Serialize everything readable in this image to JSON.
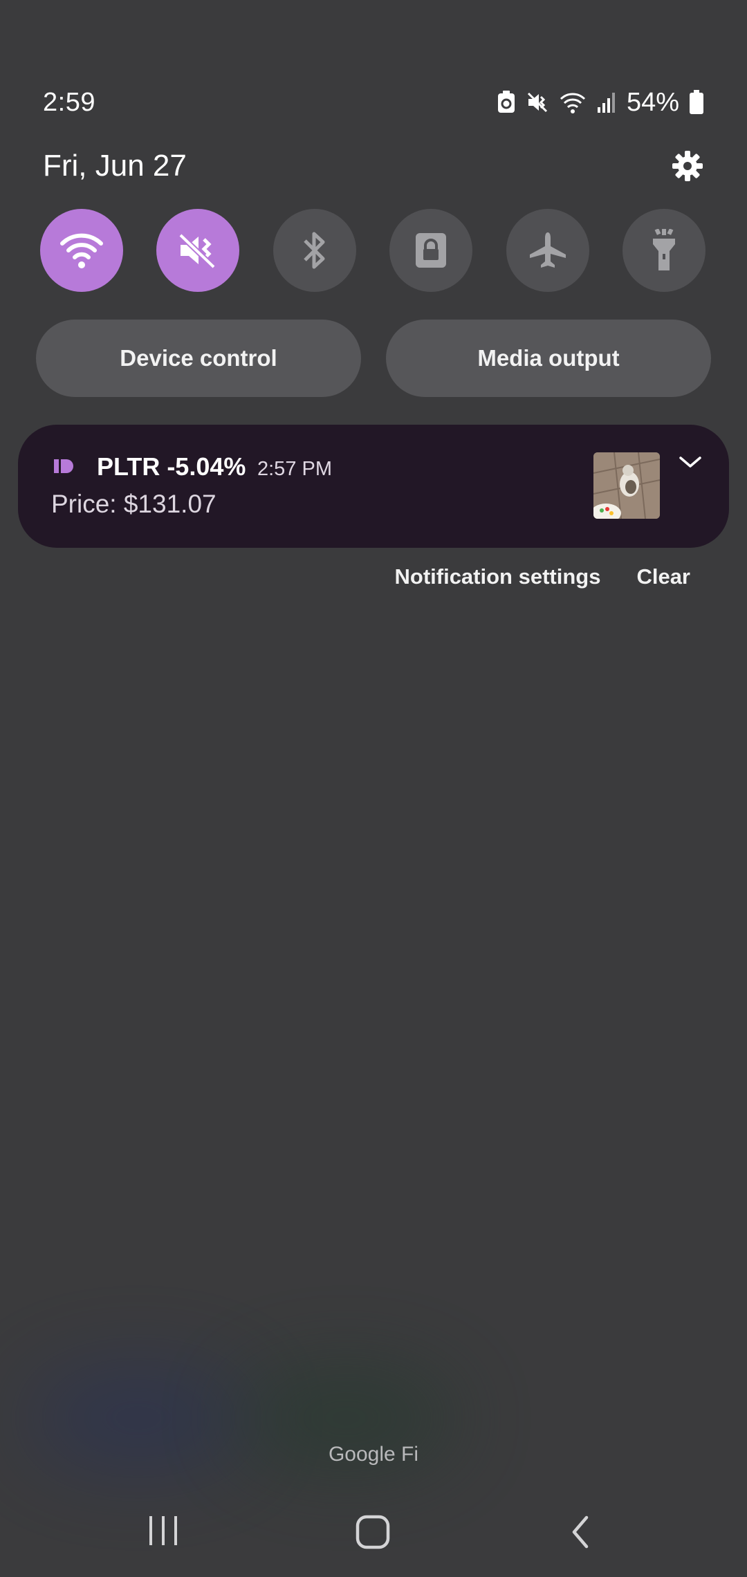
{
  "status_bar": {
    "time": "2:59",
    "battery_percent": "54%",
    "icons": [
      "battery-saver-icon",
      "mute-icon",
      "wifi-icon",
      "signal-icon",
      "battery-icon"
    ]
  },
  "header": {
    "date": "Fri, Jun 27",
    "settings_icon": "gear-icon"
  },
  "quick_toggles": [
    {
      "name": "wifi",
      "icon": "wifi-icon",
      "on": true
    },
    {
      "name": "mute",
      "icon": "mute-icon",
      "on": true
    },
    {
      "name": "bluetooth",
      "icon": "bluetooth-icon",
      "on": false
    },
    {
      "name": "rotation-lock",
      "icon": "lock-icon",
      "on": false
    },
    {
      "name": "airplane-mode",
      "icon": "airplane-icon",
      "on": false
    },
    {
      "name": "flashlight",
      "icon": "flashlight-icon",
      "on": false
    }
  ],
  "buttons": {
    "device_control": "Device control",
    "media_output": "Media output"
  },
  "notification": {
    "title": "PLTR -5.04%",
    "time": "2:57 PM",
    "body": "Price: $131.07",
    "app_icon": "app-icon",
    "expand_icon": "chevron-down-icon"
  },
  "notification_actions": {
    "settings": "Notification settings",
    "clear": "Clear"
  },
  "carrier": "Google Fi",
  "navigation": {
    "recents_icon": "recents-icon",
    "home_icon": "home-icon",
    "back_icon": "back-icon"
  },
  "colors": {
    "accent": "#b77ad9",
    "background": "#3b3b3d",
    "notification_bg": "#221726"
  }
}
